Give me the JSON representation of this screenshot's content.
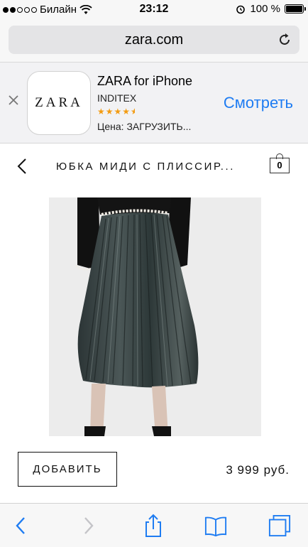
{
  "status_bar": {
    "carrier": "Билайн",
    "time": "23:12",
    "battery": "100 %",
    "signal_bars_filled": 2,
    "signal_bars_total": 5
  },
  "browser": {
    "url": "zara.com"
  },
  "app_banner": {
    "app_name": "ZARA for iPhone",
    "developer": "INDITEX",
    "rating": "4.5",
    "price_label": "Цена: ЗАГРУЗИТЬ...",
    "view_button": "Смотреть",
    "icon_logo_text": "ZARA"
  },
  "product": {
    "title": "ЮБКА МИДИ С ПЛИССИР...",
    "cart_count": "0",
    "add_button": "ДОБАВИТЬ",
    "price": "3 999 руб."
  },
  "colors": {
    "link_blue": "#1e7cf2",
    "star_orange": "#f39c12"
  }
}
